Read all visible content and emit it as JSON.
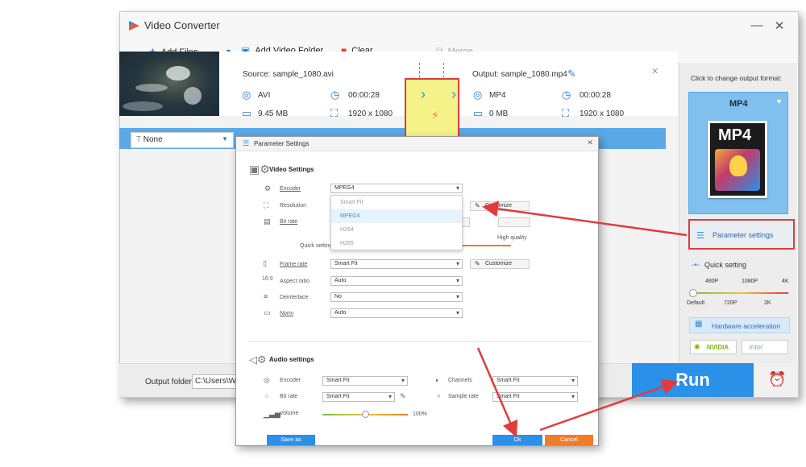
{
  "app": {
    "title": "Video Converter",
    "controls": {
      "minimize": "—",
      "close": "✕"
    }
  },
  "toolbar": {
    "add_files": "Add Files",
    "add_folder": "Add Video Folder",
    "clear": "Clear",
    "merge": "Merge"
  },
  "file": {
    "source_label": "Source: sample_1080.avi",
    "source_format": "AVI",
    "source_duration": "00:00:28",
    "source_size": "9.45 MB",
    "source_resolution": "1920 x 1080",
    "output_label": "Output: sample_1080.mp4",
    "output_format": "MP4",
    "output_duration": "00:00:28",
    "output_size": "0 MB",
    "output_resolution": "1920 x 1080",
    "subtitle_select": "None"
  },
  "right_panel": {
    "change_format_hint": "Click to change output format:",
    "format_name": "MP4",
    "format_icon_text": "MP4",
    "parameter_settings": "Parameter settings",
    "quick_setting": "Quick setting",
    "quality_top_labels": [
      "480P",
      "1080P",
      "4K"
    ],
    "quality_bottom_labels": [
      "Default",
      "720P",
      "2K"
    ],
    "quality_level": 0,
    "hardware_acceleration": "Hardware acceleration",
    "nvidia": "NVIDIA",
    "intel": "Intel"
  },
  "bottom": {
    "output_folder_label": "Output folder:",
    "output_folder_value": "C:\\Users\\Wond",
    "run": "Run"
  },
  "dialog": {
    "title": "Parameter Settings",
    "video_settings": "Video Settings",
    "encoder_label": "Encoder",
    "encoder_value": "MPEG4",
    "encoder_options": [
      "Smart Fit",
      "MPEG4",
      "H264",
      "H265"
    ],
    "encoder_selected_option": "MPEG4",
    "resolution_label": "Resolution",
    "bitrate_label": "Bit rate",
    "quick_setting_label": "Quick setting",
    "high_quality": "High quality",
    "customize": "Customize",
    "frame_rate_label": "Frame rate",
    "frame_rate_value": "Smart Fit",
    "aspect_ratio_label": "Aspect ratio",
    "aspect_ratio_value": "Auto",
    "deinterlace_label": "Deinterlace",
    "deinterlace_value": "No",
    "norm_label": "Norm",
    "norm_value": "Auto",
    "audio_settings": "Audio settings",
    "audio_encoder_label": "Encoder",
    "audio_encoder_value": "Smart Fit",
    "audio_bitrate_label": "Bit rate",
    "audio_bitrate_value": "Smart Fit",
    "channels_label": "Channels",
    "channels_value": "Smart Fit",
    "sample_rate_label": "Sample rate",
    "sample_rate_value": "Smart Fit",
    "volume_label": "Volume",
    "volume_value": "100%",
    "volume_level": 0.5,
    "save_as": "Save as",
    "ok": "Ok",
    "cancel": "Cancel"
  },
  "colors": {
    "accent": "#2b90e8",
    "annotation_red": "#e23b3b",
    "highlight_yellow": "#f6f28a",
    "cancel_orange": "#f07c2a"
  }
}
